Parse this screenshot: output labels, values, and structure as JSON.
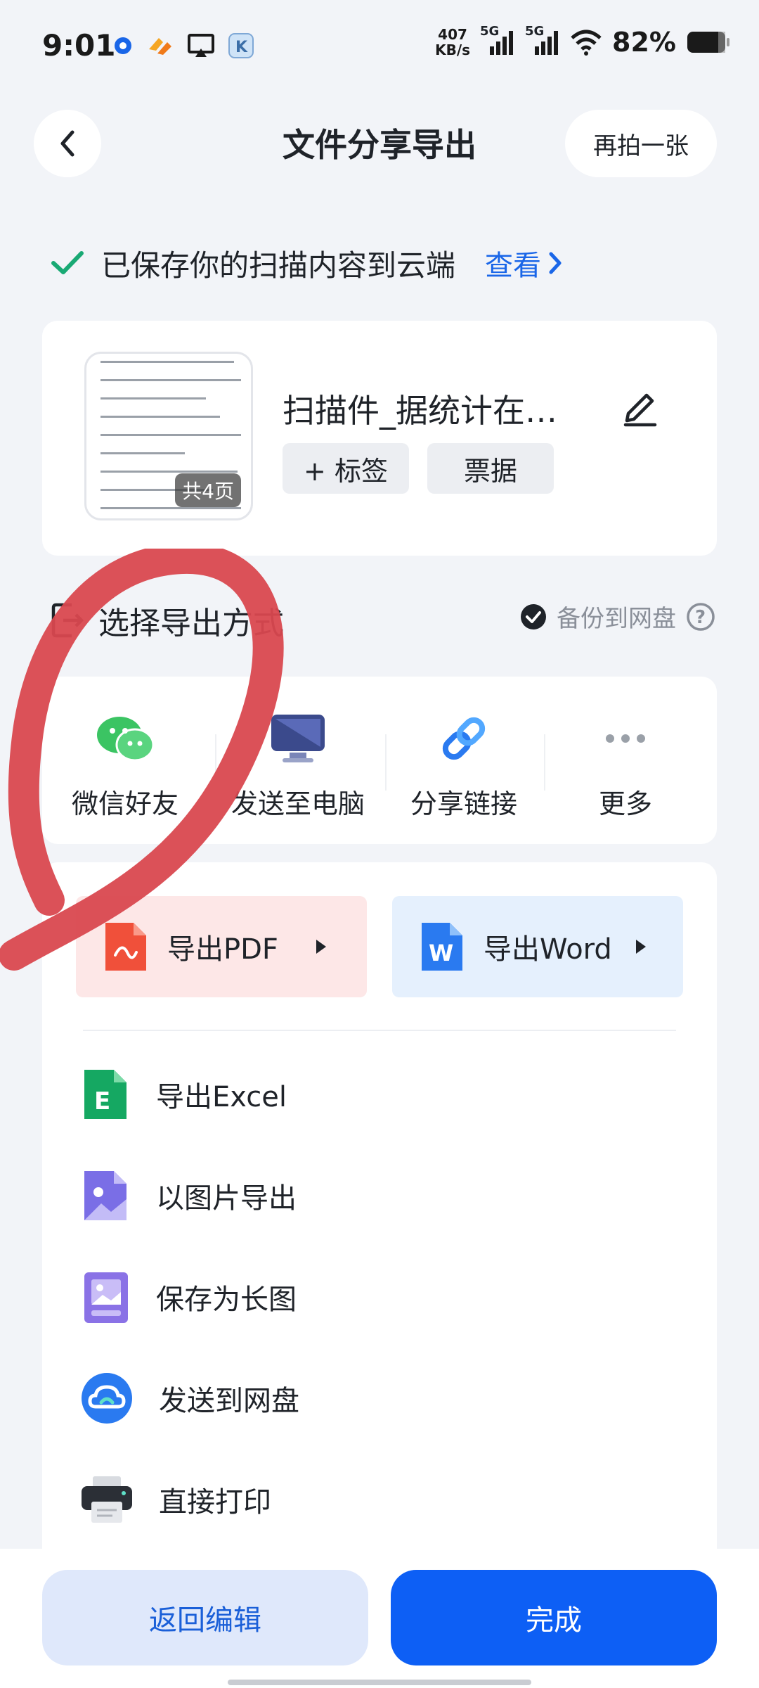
{
  "status_bar": {
    "time": "9:01",
    "speed_value": "407",
    "speed_unit": "KB/s",
    "signal_1": "5G",
    "signal_2": "5G",
    "battery": "82%"
  },
  "header": {
    "title": "文件分享导出",
    "retake_label": "再拍一张"
  },
  "saved_notice": {
    "text": "已保存你的扫描内容到云端",
    "link_label": "查看"
  },
  "file": {
    "name": "扫描件_据统计在…",
    "page_badge": "共4页",
    "tag_label": "+ 标签",
    "category_label": "票据"
  },
  "export_section": {
    "title": "选择导出方式",
    "backup_label": "备份到网盘"
  },
  "share_options": [
    {
      "label": "微信好友",
      "icon": "wechat-icon"
    },
    {
      "label": "发送至电脑",
      "icon": "computer-icon"
    },
    {
      "label": "分享链接",
      "icon": "link-icon"
    },
    {
      "label": "更多",
      "icon": "more-icon"
    }
  ],
  "export_buttons": {
    "pdf": "导出PDF",
    "word": "导出Word"
  },
  "export_list": [
    {
      "label": "导出Excel",
      "icon": "excel-icon"
    },
    {
      "label": "以图片导出",
      "icon": "image-icon"
    },
    {
      "label": "保存为长图",
      "icon": "long-image-icon"
    },
    {
      "label": "发送到网盘",
      "icon": "cloud-drive-icon"
    },
    {
      "label": "直接打印",
      "icon": "printer-icon"
    }
  ],
  "bottom": {
    "back_edit": "返回编辑",
    "done": "完成"
  },
  "colors": {
    "accent": "#0d5ff5",
    "link": "#1a66e8",
    "check": "#19a974",
    "annotation": "#d9484f",
    "pdf_bg": "#fde7e7",
    "word_bg": "#e5f0fd"
  }
}
